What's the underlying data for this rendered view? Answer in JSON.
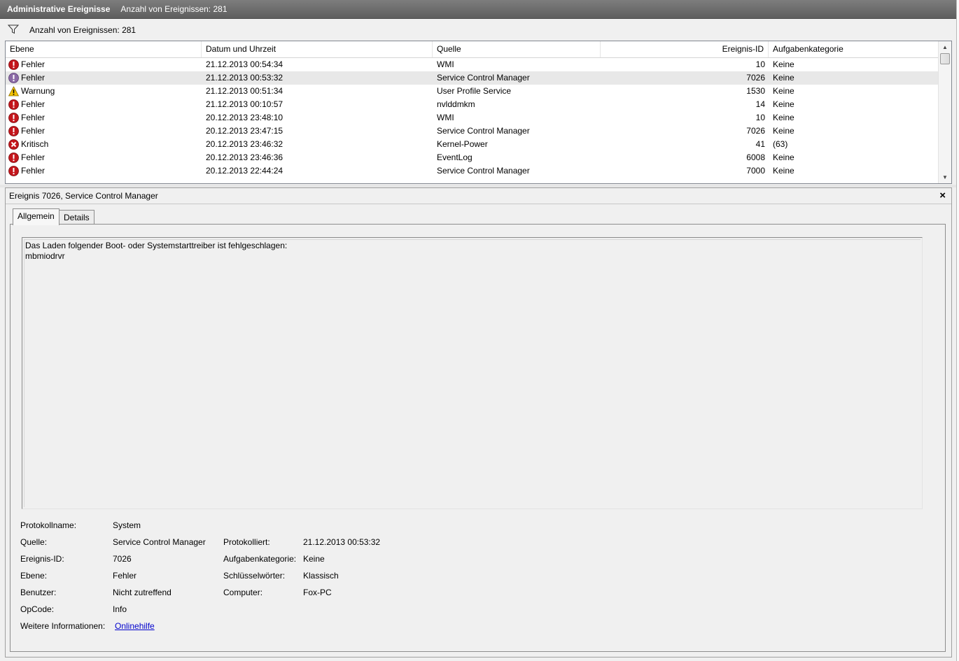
{
  "titlebar": {
    "title": "Administrative Ereignisse",
    "subtitle": "Anzahl von Ereignissen: 281"
  },
  "filterbar": {
    "icon": "filter-icon",
    "text": "Anzahl von Ereignissen: 281"
  },
  "grid": {
    "columns": {
      "level": "Ebene",
      "datetime": "Datum und Uhrzeit",
      "source": "Quelle",
      "eventid": "Ereignis-ID",
      "category": "Aufgabenkategorie"
    },
    "rows": [
      {
        "level": "Fehler",
        "icon": "error",
        "datetime": "21.12.2013 00:54:34",
        "source": "WMI",
        "eventid": "10",
        "category": "Keine"
      },
      {
        "level": "Fehler",
        "icon": "error-selected",
        "datetime": "21.12.2013 00:53:32",
        "source": "Service Control Manager",
        "eventid": "7026",
        "category": "Keine"
      },
      {
        "level": "Warnung",
        "icon": "warning",
        "datetime": "21.12.2013 00:51:34",
        "source": "User Profile Service",
        "eventid": "1530",
        "category": "Keine"
      },
      {
        "level": "Fehler",
        "icon": "error",
        "datetime": "21.12.2013 00:10:57",
        "source": "nvlddmkm",
        "eventid": "14",
        "category": "Keine"
      },
      {
        "level": "Fehler",
        "icon": "error",
        "datetime": "20.12.2013 23:48:10",
        "source": "WMI",
        "eventid": "10",
        "category": "Keine"
      },
      {
        "level": "Fehler",
        "icon": "error",
        "datetime": "20.12.2013 23:47:15",
        "source": "Service Control Manager",
        "eventid": "7026",
        "category": "Keine"
      },
      {
        "level": "Kritisch",
        "icon": "critical",
        "datetime": "20.12.2013 23:46:32",
        "source": "Kernel-Power",
        "eventid": "41",
        "category": "(63)"
      },
      {
        "level": "Fehler",
        "icon": "error",
        "datetime": "20.12.2013 23:46:36",
        "source": "EventLog",
        "eventid": "6008",
        "category": "Keine"
      },
      {
        "level": "Fehler",
        "icon": "error",
        "datetime": "20.12.2013 22:44:24",
        "source": "Service Control Manager",
        "eventid": "7000",
        "category": "Keine"
      }
    ],
    "selected_index": 1
  },
  "detail": {
    "title": "Ereignis 7026, Service Control Manager",
    "close": "×",
    "tabs": [
      "Allgemein",
      "Details"
    ],
    "active_tab": "Allgemein",
    "message_line1": "Das Laden folgender Boot- oder Systemstarttreiber ist fehlgeschlagen:",
    "message_line2": "mbmiodrvr",
    "props": {
      "logname_label": "Protokollname:",
      "logname_value": "System",
      "source_label": "Quelle:",
      "source_value": "Service Control Manager",
      "logged_label": "Protokolliert:",
      "logged_value": "21.12.2013 00:53:32",
      "eventid_label": "Ereignis-ID:",
      "eventid_value": "7026",
      "category_label": "Aufgabenkategorie:",
      "category_value": "Keine",
      "level_label": "Ebene:",
      "level_value": "Fehler",
      "keywords_label": "Schlüsselwörter:",
      "keywords_value": "Klassisch",
      "user_label": "Benutzer:",
      "user_value": "Nicht zutreffend",
      "computer_label": "Computer:",
      "computer_value": "Fox-PC",
      "opcode_label": "OpCode:",
      "opcode_value": "Info",
      "moreinfo_label": "Weitere Informationen:",
      "moreinfo_link": "Onlinehilfe"
    }
  },
  "colors": {
    "error": "#c4161c",
    "critical": "#c4161c",
    "warning": "#f3c200",
    "selected_row": "#e8e8e8",
    "link": "#0000cc"
  }
}
